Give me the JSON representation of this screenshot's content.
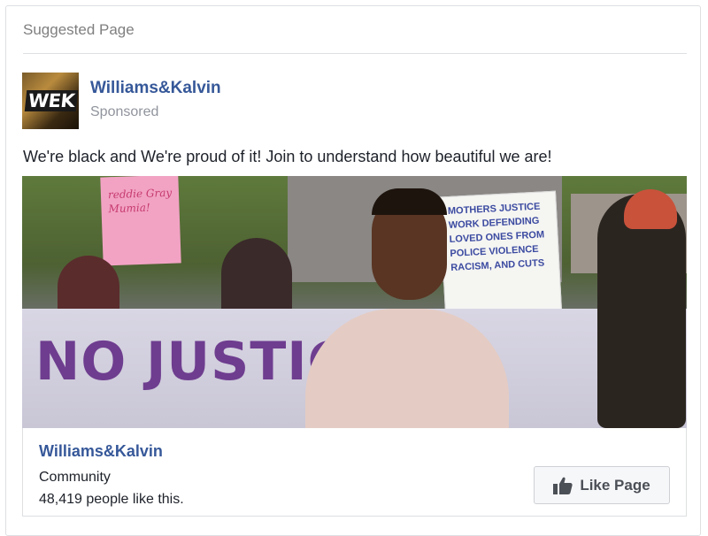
{
  "header": {
    "label": "Suggested Page"
  },
  "post": {
    "page_name": "Williams&Kalvin",
    "sponsored_label": "Sponsored",
    "avatar_text": "WEK",
    "text": "We're black and We're proud of it! Join to understand how beautiful we are!"
  },
  "media": {
    "sign_left": "reddie Gray Mumia!",
    "sign_right": "MOTHERS JUSTICE WORK DEFENDING LOVED ONES FROM POLICE VIOLENCE RACISM, AND CUTS",
    "banner_text": "NO JUSTIC"
  },
  "link_card": {
    "name": "Williams&Kalvin",
    "category": "Community",
    "likes_text": "48,419 people like this.",
    "like_button_label": "Like Page"
  },
  "icons": {
    "like_button_icon": "thumbs-up-icon"
  },
  "colors": {
    "link_blue": "#365899",
    "muted_gray": "#90949c",
    "border": "#dddfe2"
  }
}
